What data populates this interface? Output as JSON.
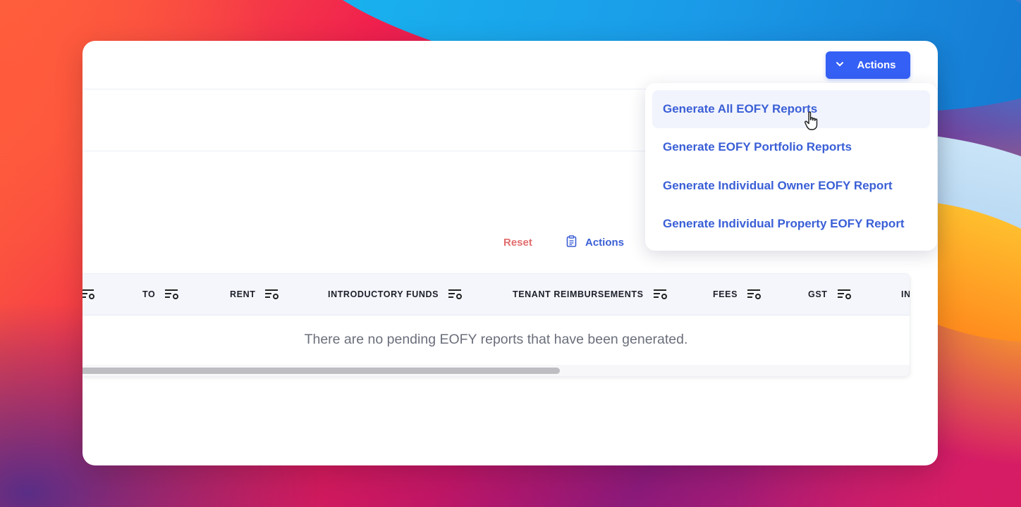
{
  "toolbar": {
    "actions_button_label": "Actions"
  },
  "filters": {
    "reset_label": "Reset",
    "actions_label": "Actions"
  },
  "table": {
    "columns": [
      "TO",
      "RENT",
      "INTRODUCTORY FUNDS",
      "TENANT REIMBURSEMENTS",
      "FEES",
      "GST",
      "IN"
    ],
    "empty_message": "There are no pending EOFY reports that have been generated."
  },
  "dropdown": {
    "items": [
      "Generate All EOFY Reports",
      "Generate EOFY Portfolio Reports",
      "Generate Individual Owner EOFY Report",
      "Generate Individual Property EOFY Report"
    ]
  },
  "colors": {
    "primary": "#3560f5",
    "link": "#3a5fd6",
    "reset": "#e26d6d"
  }
}
